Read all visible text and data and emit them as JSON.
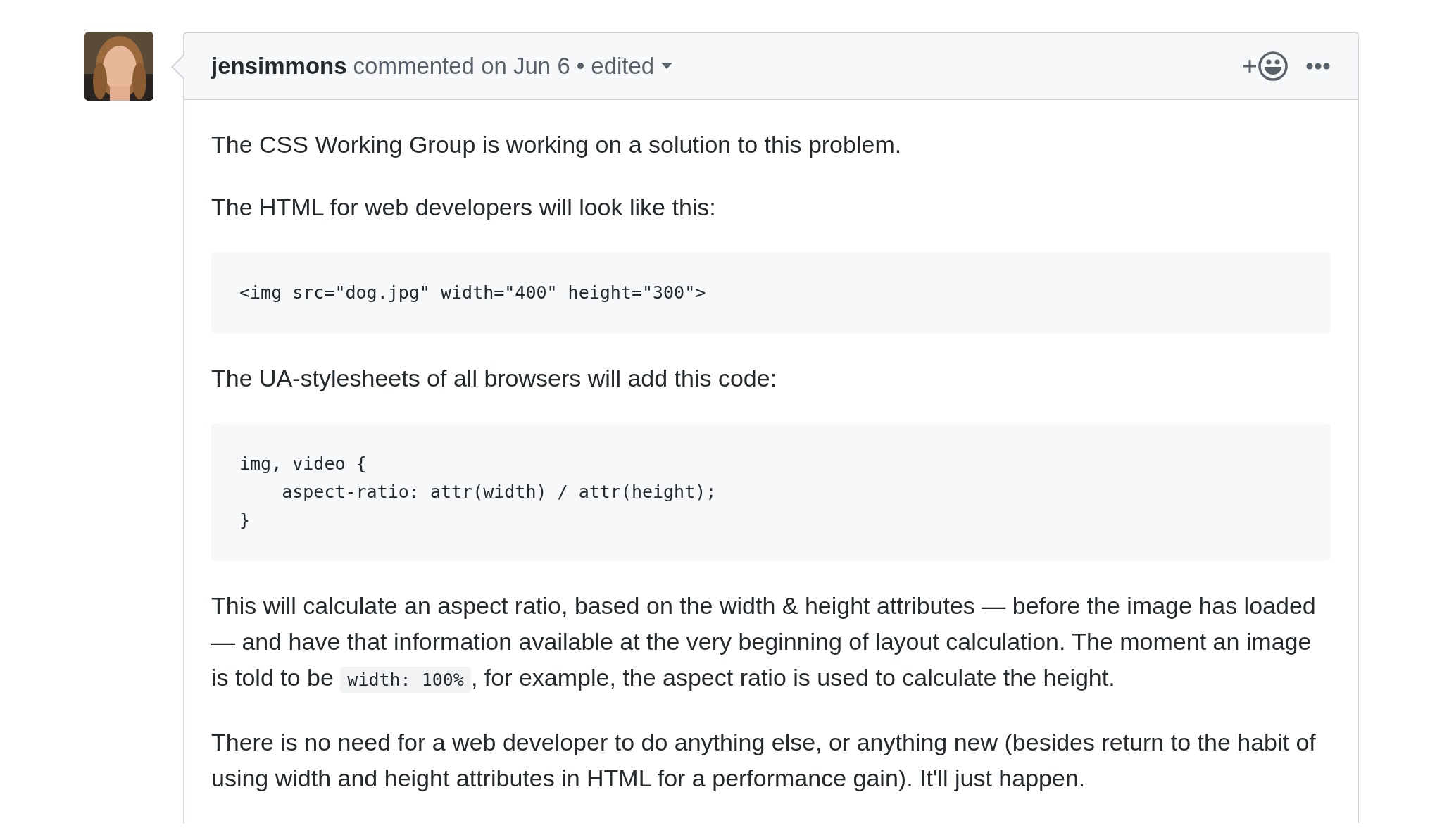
{
  "comment": {
    "author": "jensimmons",
    "action": "commented on Jun 6",
    "separator": "•",
    "edited": "edited",
    "blocks": [
      {
        "kind": "paragraph",
        "runs": [
          {
            "kind": "text",
            "text": "The CSS Working Group is working on a solution to this problem."
          }
        ]
      },
      {
        "kind": "paragraph",
        "runs": [
          {
            "kind": "text",
            "text": "The HTML for web developers will look like this:"
          }
        ]
      },
      {
        "kind": "code",
        "lines": [
          "<img src=\"dog.jpg\" width=\"400\" height=\"300\">"
        ]
      },
      {
        "kind": "paragraph",
        "runs": [
          {
            "kind": "text",
            "text": "The UA-stylesheets of all browsers will add this code:"
          }
        ]
      },
      {
        "kind": "code",
        "lines": [
          "img, video {",
          "    aspect-ratio: attr(width) / attr(height);",
          "}"
        ]
      },
      {
        "kind": "paragraph",
        "runs": [
          {
            "kind": "text",
            "text": "This will calculate an aspect ratio, based on the width & height attributes — before the image has loaded — and have that information available at the very beginning of layout calculation. The moment an image is told to be "
          },
          {
            "kind": "code",
            "text": "width: 100%"
          },
          {
            "kind": "text",
            "text": ", for example, the aspect ratio is used to calculate the height."
          }
        ]
      },
      {
        "kind": "paragraph",
        "runs": [
          {
            "kind": "text",
            "text": "There is no need for a web developer to do anything else, or anything new (besides return to the habit of using width and height attributes in HTML for a performance gain). It'll just happen."
          }
        ]
      }
    ]
  }
}
